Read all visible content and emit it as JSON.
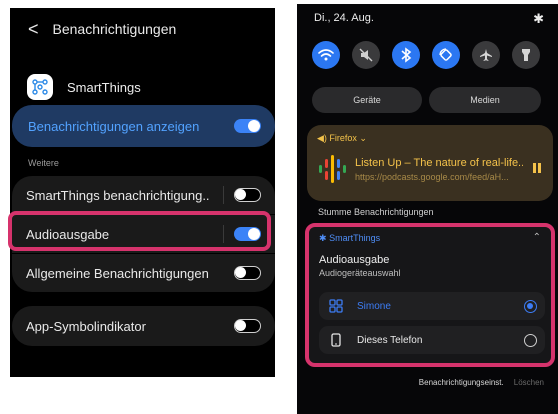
{
  "left": {
    "header": {
      "back": "<",
      "title": "Benachrichtigungen"
    },
    "app": {
      "name": "SmartThings",
      "icon": "smartthings-icon"
    },
    "master": {
      "label": "Benachrichtigungen anzeigen",
      "state": "on"
    },
    "section_label": "Weitere",
    "rows": [
      {
        "label": "SmartThings benachrichtigung..",
        "state": "off"
      },
      {
        "label": "Audioausgabe",
        "state": "on"
      },
      {
        "label": "Allgemeine Benachrichtigungen",
        "state": "off"
      },
      {
        "label": "App-Symbolindikator",
        "state": "off"
      }
    ]
  },
  "right": {
    "status": {
      "date": "Di., 24. Aug.",
      "settings_icon": "gear-icon"
    },
    "quick_settings": [
      {
        "icon": "wifi-icon",
        "state": "on"
      },
      {
        "icon": "mute-icon",
        "state": "off"
      },
      {
        "icon": "bluetooth-icon",
        "state": "on"
      },
      {
        "icon": "auto-rotate-icon",
        "state": "on"
      },
      {
        "icon": "airplane-icon",
        "state": "off"
      },
      {
        "icon": "flashlight-icon",
        "state": "off"
      }
    ],
    "pills": {
      "devices": "Geräte",
      "media": "Medien"
    },
    "media": {
      "source": "◀) Firefox ⌄",
      "title": "Listen Up – The nature of real-life...",
      "url": "https://podcasts.google.com/feed/aH..."
    },
    "silent_label": "Stumme Benachrichtigungen",
    "notification": {
      "app": "SmartThings",
      "title": "Audioausgabe",
      "subtitle": "Audiogeräteauswahl",
      "options": [
        {
          "label": "Simone",
          "icon": "device-group-icon",
          "selected": true
        },
        {
          "label": "Dieses Telefon",
          "icon": "phone-icon",
          "selected": false
        }
      ]
    },
    "footer": {
      "settings": "Benachrichtigungseinst.",
      "clear": "Löschen"
    }
  },
  "colors": {
    "accent": "#3b83f7",
    "highlight": "#d6336c",
    "media_text": "#f4c24a"
  }
}
